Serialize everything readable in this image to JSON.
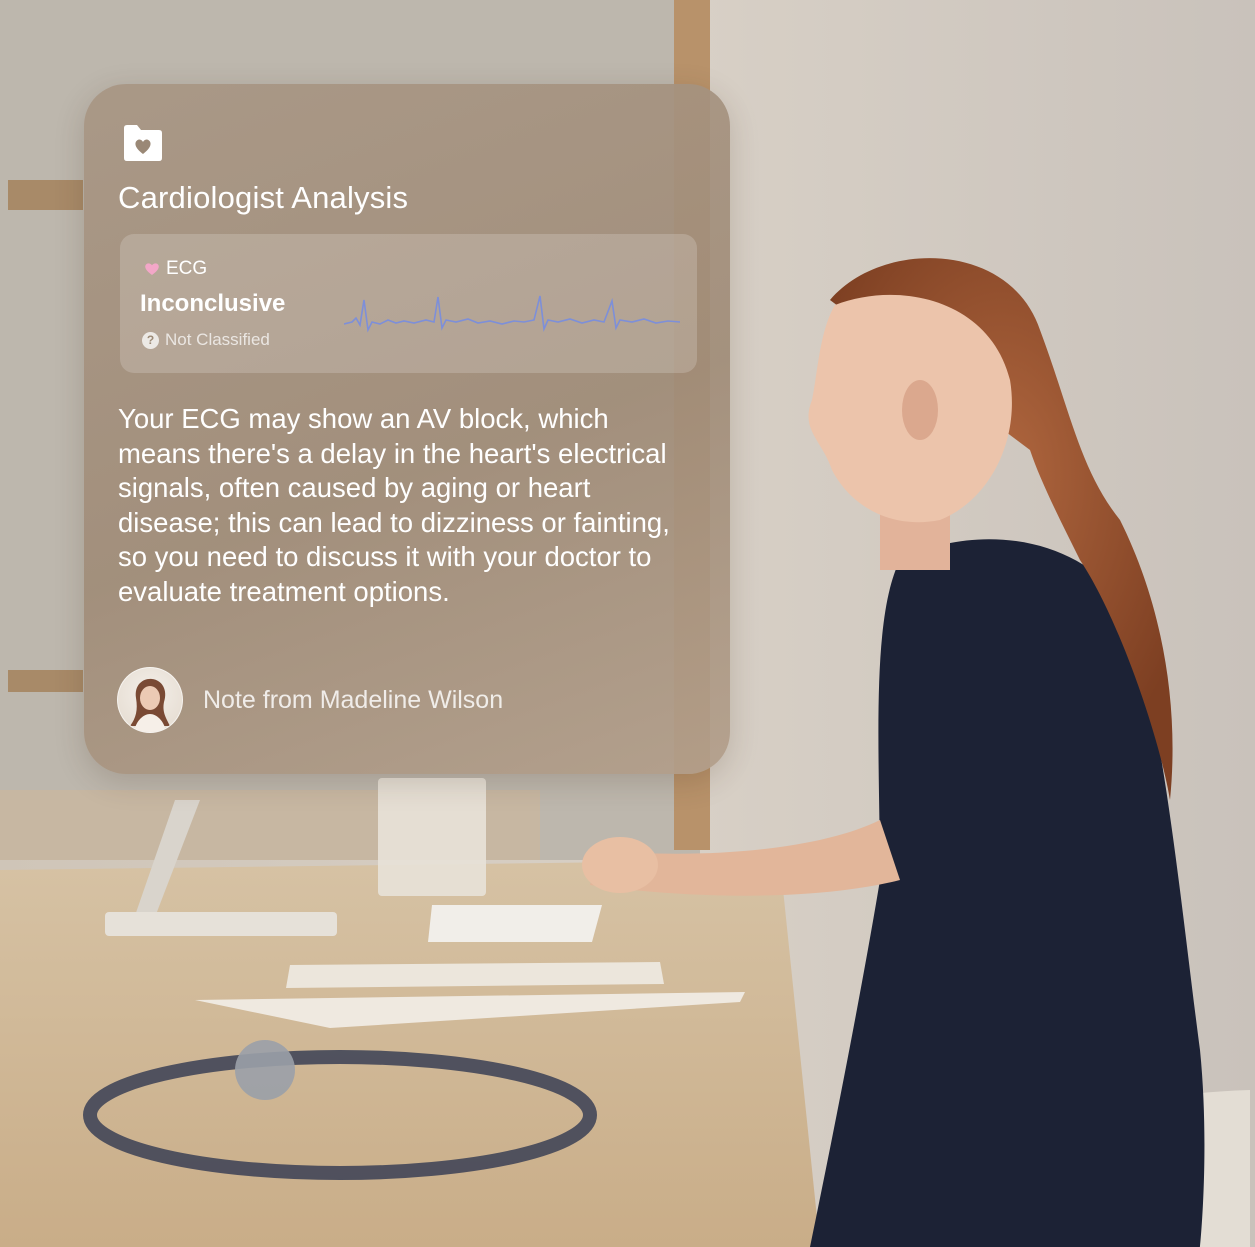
{
  "card": {
    "icon": "heart-folder-icon",
    "title": "Cardiologist Analysis",
    "ecg": {
      "tag_icon": "heart-icon",
      "tag_label": "ECG",
      "status": "Inconclusive",
      "classification_icon": "question-icon",
      "classification": "Not Classified",
      "trace_color": "#7d8fd9"
    },
    "note": "Your ECG may show an AV block, which means there's a delay in the heart's electrical signals, often caused by aging or heart disease; this can lead to dizziness or fainting, so you need to discuss it with your doctor to evaluate treatment options.",
    "author": {
      "avatar": "doctor-avatar",
      "label": "Note from Madeline Wilson"
    }
  },
  "colors": {
    "heart": "#f3a7c8",
    "card_tint": "#a89684"
  }
}
